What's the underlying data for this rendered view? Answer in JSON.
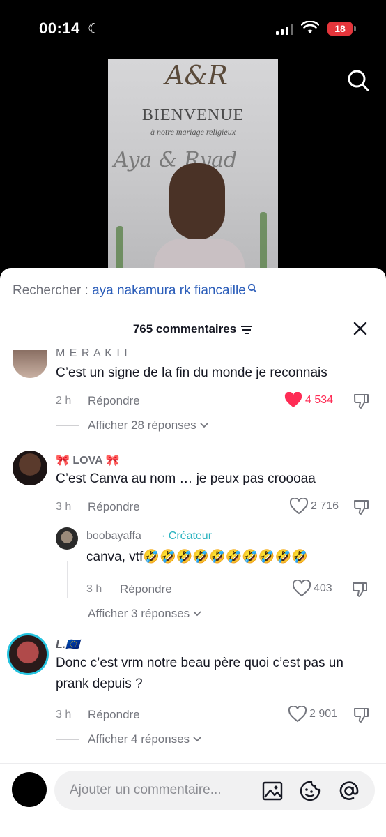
{
  "status": {
    "time": "00:14",
    "battery": "18"
  },
  "video": {
    "monogram": "A&R",
    "welcome": "BIENVENUE",
    "subtitle": "à notre mariage religieux",
    "names": "Aya & Ryad"
  },
  "search_hint": {
    "prefix": "Rechercher :",
    "query": "aya nakamura rk fiancaille"
  },
  "comments_count": "765 commentaires",
  "comments": [
    {
      "username": "M E R A K I I",
      "text": "C’est un signe de la fin du monde je reconnais",
      "time": "2 h",
      "reply": "Répondre",
      "likes": "4 534",
      "liked": true,
      "more": "Afficher 28 réponses"
    },
    {
      "username": "🎀 LOVA 🎀",
      "text": "C’est Canva au nom … je peux pas croooaa",
      "time": "3 h",
      "reply": "Répondre",
      "likes": "2 716",
      "liked": false
    },
    {
      "username": "boobayaffa_",
      "badge": "Créateur",
      "text": "canva, vtf🤣🤣🤣🤣🤣🤣🤣🤣🤣🤣",
      "time": "3 h",
      "reply": "Répondre",
      "likes": "403",
      "liked": false,
      "more": "Afficher 3 réponses"
    },
    {
      "username": "L.🇪🇺",
      "text": "Donc c’est vrm notre beau père quoi c’est pas un prank depuis ?",
      "time": "3 h",
      "reply": "Répondre",
      "likes": "2 901",
      "liked": false,
      "more": "Afficher 4 réponses"
    }
  ],
  "composer": {
    "placeholder": "Ajouter un commentaire..."
  },
  "colors": {
    "like_red": "#fe2c55",
    "link_blue": "#2b5db9",
    "creator_teal": "#2bb3c0"
  }
}
